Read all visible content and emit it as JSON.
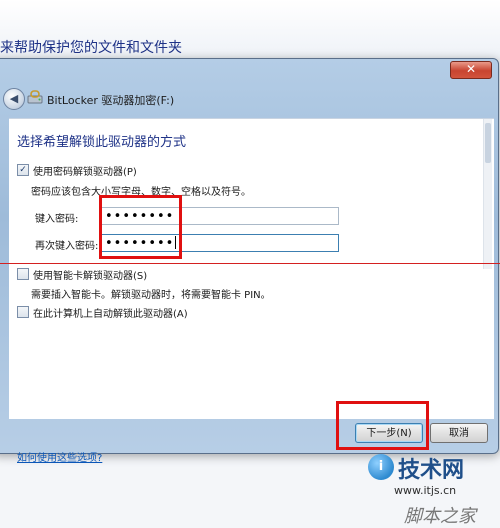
{
  "background": {
    "heading": "来帮助保护您的文件和文件夹"
  },
  "window": {
    "close_glyph": "✕",
    "nav_back_glyph": "◀",
    "title": "BitLocker 驱动器加密(F:)"
  },
  "page": {
    "heading": "选择希望解锁此驱动器的方式",
    "option_password": {
      "label": "使用密码解锁驱动器(P)",
      "checked": true,
      "note": "密码应该包含大小写字母、数字、空格以及符号。",
      "enter_label": "键入密码:",
      "enter_value": "••••••••",
      "reenter_label": "再次键入密码:",
      "reenter_value": "••••••••"
    },
    "option_smartcard": {
      "label": "使用智能卡解锁驱动器(S)",
      "checked": false,
      "note": "需要插入智能卡。解锁驱动器时，将需要智能卡 PIN。"
    },
    "option_auto": {
      "label": "在此计算机上自动解锁此驱动器(A)",
      "checked": false
    },
    "help_link": "如何使用这些选项?"
  },
  "footer": {
    "next_label": "下一步(N)",
    "cancel_label": "取消"
  },
  "watermark": {
    "logo_letter": "i",
    "brand": "技术网",
    "url": "www.itjs.cn",
    "sub": "脚本之家"
  },
  "colors": {
    "heading_blue": "#1e3287",
    "link_blue": "#0a56b8",
    "highlight_red": "#e01010"
  }
}
